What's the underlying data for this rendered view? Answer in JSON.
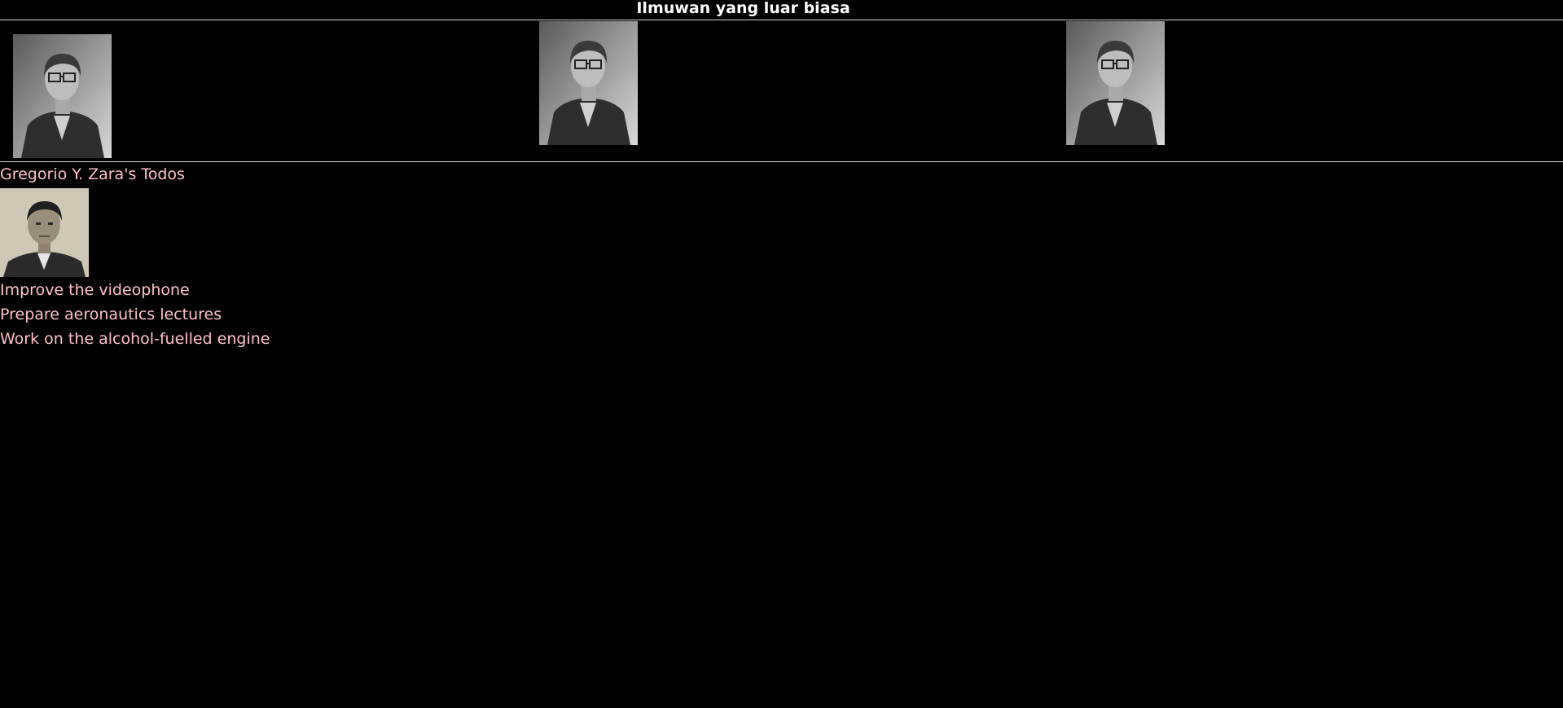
{
  "header": {
    "title": "Ilmuwan yang luar biasa"
  },
  "gallery": {
    "photos": [
      {
        "icon": "portrait-woman-glasses-image"
      },
      {
        "icon": "portrait-woman-glasses-image"
      },
      {
        "icon": "portrait-woman-glasses-image"
      }
    ]
  },
  "todos": {
    "heading": "Gregorio Y. Zara's Todos",
    "avatar_icon": "portrait-man-image",
    "items": [
      "Improve the videophone",
      "Prepare aeronautics lectures",
      "Work on the alcohol-fuelled engine"
    ]
  },
  "colors": {
    "background": "#000000",
    "title_text": "#ffffff",
    "list_text": "#ffc0cb",
    "rule": "#d9d9d9"
  }
}
